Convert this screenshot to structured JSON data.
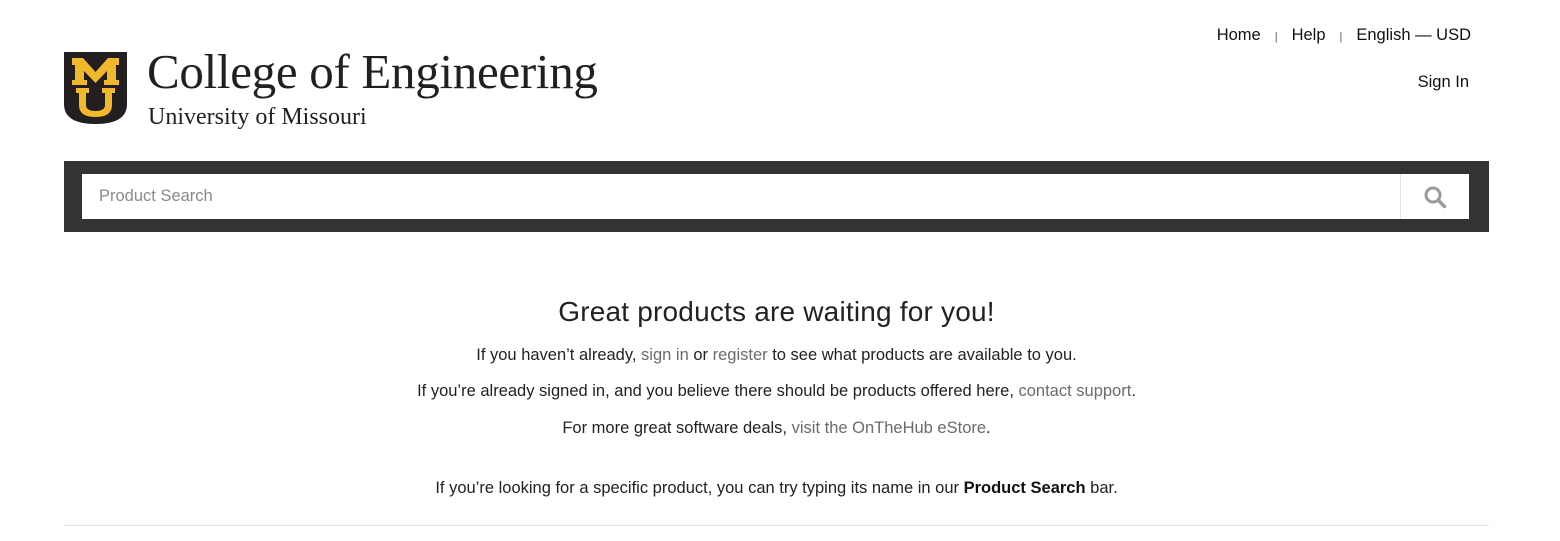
{
  "header": {
    "logo_letters": "MU",
    "brand_title": "College of Engineering",
    "brand_subtitle": "University of Missouri",
    "colors": {
      "logo_black": "#231f20",
      "logo_gold": "#f1b82d"
    }
  },
  "top_nav": {
    "home": "Home",
    "sep1": "|",
    "help": "Help",
    "sep2": "|",
    "locale": "English — USD",
    "sign_in": "Sign In"
  },
  "search": {
    "placeholder": "Product Search",
    "value": "",
    "icon": "search-icon",
    "bar_color": "#333333"
  },
  "main": {
    "headline": "Great products are waiting for you!",
    "line1": {
      "before": "If you haven’t already, ",
      "sign_in": "sign in",
      "or": " or ",
      "register": "register",
      "after": " to see what products are available to you."
    },
    "line2": {
      "before": "If you’re already signed in, and you believe there should be products offered here, ",
      "contact_support": "contact support",
      "after": "."
    },
    "line3": {
      "before": "For more great software deals, ",
      "estore": "visit the OnTheHub eStore",
      "after": "."
    },
    "line4": {
      "before": "If you’re looking for a specific product, you can try typing its name in our ",
      "strong": "Product Search",
      "after": " bar."
    }
  }
}
